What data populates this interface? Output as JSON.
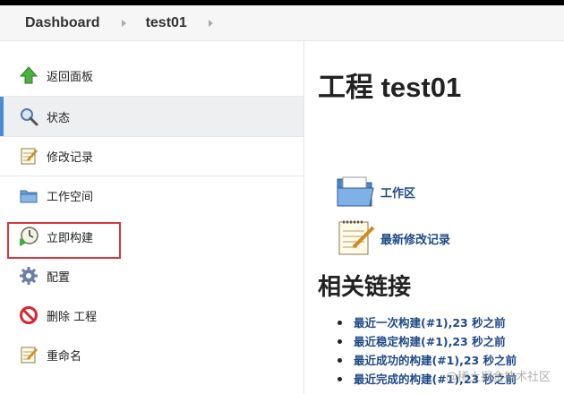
{
  "breadcrumb": {
    "items": [
      "Dashboard",
      "test01"
    ]
  },
  "sidebar": {
    "items": [
      {
        "label": "返回面板",
        "icon": "up-arrow-icon"
      },
      {
        "label": "状态",
        "icon": "magnifier-icon",
        "active": true
      },
      {
        "label": "修改记录",
        "icon": "notepad-icon"
      },
      {
        "label": "工作空间",
        "icon": "folder-icon"
      },
      {
        "label": "立即构建",
        "icon": "clock-build-icon"
      },
      {
        "label": "配置",
        "icon": "gear-icon"
      },
      {
        "label": "删除 工程",
        "icon": "no-entry-icon"
      },
      {
        "label": "重命名",
        "icon": "notepad-icon"
      }
    ]
  },
  "main": {
    "title": "工程 test01",
    "links": [
      {
        "label": "工作区",
        "icon": "folder-open-icon"
      },
      {
        "label": "最新修改记录",
        "icon": "notepad-icon"
      }
    ],
    "related_heading": "相关链接",
    "related_links": [
      "最近一次构建(#1),23 秒之前",
      "最近稳定构建(#1),23 秒之前",
      "最近成功的构建(#1),23 秒之前",
      "最近完成的构建(#1),23 秒之前"
    ]
  },
  "watermark": "@稀土掘金技术社区",
  "colors": {
    "accent": "#4b8cd9",
    "link": "#204a87",
    "highlight": "#d9363e"
  }
}
